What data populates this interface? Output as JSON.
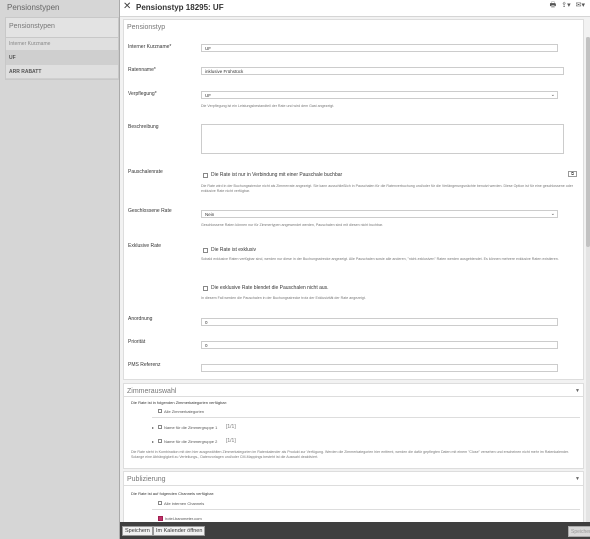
{
  "background": {
    "title": "Pensionstypen",
    "list_head": "Pensionstypen",
    "column_header": "Interner Kurzname",
    "rows": [
      "UF",
      "ARR RABATT"
    ]
  },
  "dialog": {
    "title": "Pensionstyp 18295: UF",
    "header_icons": [
      "printer-icon",
      "share-icon",
      "comment-icon"
    ]
  },
  "pensionstyp": {
    "section_title": "Pensionstyp",
    "internal_label": "Interner Kurzname*",
    "internal_value": "UF",
    "rate_label": "Ratenname*",
    "rate_value": "inklusive Frühstück",
    "board_label": "Verpflegung*",
    "board_value": "UF",
    "board_help": "Die Verpflegung ist ein Leistungsbestandteil der Rate und wird dem Gast angezeigt.",
    "desc_label": "Beschreibung",
    "package_label": "Pauschalenrate",
    "package_checkbox": "Die Rate ist nur in Verbindung mit einer Pauschale buchbar",
    "package_help": "Die Rate wird in der Buchungsstrecke nicht als Zimmerrate angezeigt. Sie kann ausschließlich in Pauschalen für die Ratenverbuchung und/oder für die Verlängerungsnächte benutzt werden. Diese Option ist für eine geschlossene oder exklusive Rate nicht verfügbar.",
    "closed_label": "Geschlossene Rate",
    "closed_value": "Nein",
    "closed_help": "Geschlossene Raten können nur für Zimmertypen angewendet werden, Pauschalen sind mit diesen nicht buchbar.",
    "exclusive_label": "Exklusive Rate",
    "exclusive_checkbox": "Die Rate ist exklusiv",
    "exclusive_help": "Sobald exklusive Raten verfügbar sind, werden nur diese in der Buchungsstrecke angezeigt. Alle Pauschalen sowie alle anderen, \"nicht-exklusiven\" Raten werden ausgeblendet. Es können mehrere exklusive Raten existieren.",
    "hide_checkbox": "Die exklusive Rate blendet die Pauschalen nicht aus.",
    "hide_help": "In diesem Fall werden die Pauschalen in der Buchungsstrecke trotz der Exklusivität der Rate angezeigt.",
    "order_label": "Anordnung",
    "order_value": "0",
    "priority_label": "Priorität",
    "priority_value": "0",
    "pms_label": "PMS Referenz",
    "pms_value": ""
  },
  "zimmer": {
    "section_title": "Zimmerauswahl",
    "intro": "Die Rate ist in folgenden Zimmerkategorien verfügbar:",
    "all_label": "Alle Zimmerkategorien",
    "groups": [
      {
        "label": "Name für die Zimmergruppe 1",
        "count": "[1/1]"
      },
      {
        "label": "Name für die Zimmergruppe 2",
        "count": "[1/1]"
      }
    ],
    "help": "Die Rate steht in Kombination mit den hier ausgewählten Zimmerkategorien im Ratenkalender als Produkt zur Verfügung. Werden die Zimmerkategorien hier entfernt, werden die dafür gepflegten Daten mit einem \"Close\" versehen und erscheinen nicht mehr im Ratenkalender. Solange eine Abhängigkeit zu Verteilungs-, Datenvorlagen und/oder CM-Mappings besteht ist die Auswahl deaktiviert."
  },
  "publizierung": {
    "section_title": "Publizierung",
    "intro": "Die Rate ist auf folgenden Channels verfügbar:",
    "all_label": "Alle internen Channels",
    "channel": "hotel-barometer.com"
  },
  "footer": {
    "save": "Speichern",
    "calendar": "Im Kalender öffnen",
    "right": "Speichern"
  }
}
